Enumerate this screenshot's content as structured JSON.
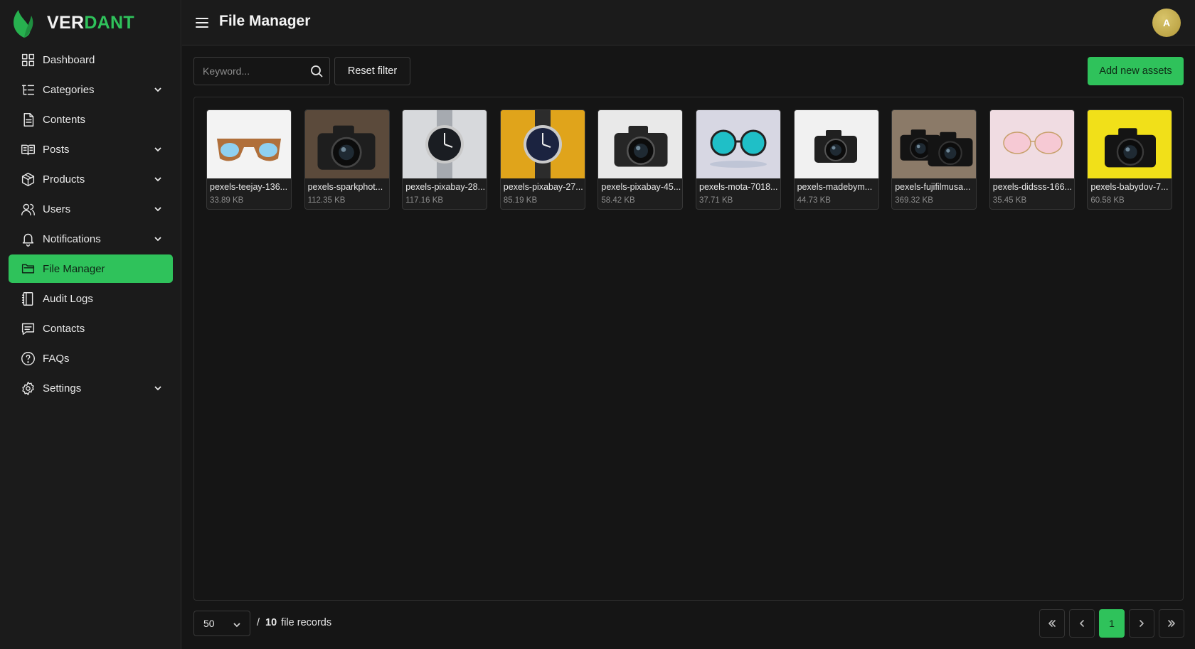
{
  "brand": {
    "name_part1": "VER",
    "name_part2": "DANT",
    "accent": "#2fc25b"
  },
  "header": {
    "title": "File Manager",
    "avatar_initial": "A"
  },
  "sidebar": {
    "items": [
      {
        "label": "Dashboard",
        "icon": "grid-icon",
        "has_chevron": false,
        "active": false
      },
      {
        "label": "Categories",
        "icon": "tree-list-icon",
        "has_chevron": true,
        "active": false
      },
      {
        "label": "Contents",
        "icon": "document-icon",
        "has_chevron": false,
        "active": false
      },
      {
        "label": "Posts",
        "icon": "open-book-icon",
        "has_chevron": true,
        "active": false
      },
      {
        "label": "Products",
        "icon": "box-icon",
        "has_chevron": true,
        "active": false
      },
      {
        "label": "Users",
        "icon": "users-icon",
        "has_chevron": true,
        "active": false
      },
      {
        "label": "Notifications",
        "icon": "bell-icon",
        "has_chevron": true,
        "active": false
      },
      {
        "label": "File Manager",
        "icon": "folders-icon",
        "has_chevron": false,
        "active": true
      },
      {
        "label": "Audit Logs",
        "icon": "notebook-icon",
        "has_chevron": false,
        "active": false
      },
      {
        "label": "Contacts",
        "icon": "chat-icon",
        "has_chevron": false,
        "active": false
      },
      {
        "label": "FAQs",
        "icon": "question-circle-icon",
        "has_chevron": false,
        "active": false
      },
      {
        "label": "Settings",
        "icon": "gear-icon",
        "has_chevron": true,
        "active": false
      }
    ]
  },
  "toolbar": {
    "search_placeholder": "Keyword...",
    "search_value": "",
    "reset_label": "Reset filter",
    "add_label": "Add new assets"
  },
  "files": [
    {
      "name": "pexels-teejay-136...",
      "size": "33.89 KB",
      "thumb": "sunglasses-wood",
      "bg": "#f3f3f3"
    },
    {
      "name": "pexels-sparkphot...",
      "size": "112.35 KB",
      "thumb": "camera-canon",
      "bg": "#5b4a3b"
    },
    {
      "name": "pexels-pixabay-28...",
      "size": "117.16 KB",
      "thumb": "watch-steel",
      "bg": "#d7d9dc"
    },
    {
      "name": "pexels-pixabay-27...",
      "size": "85.19 KB",
      "thumb": "watch-yellow",
      "bg": "#e0a41b"
    },
    {
      "name": "pexels-pixabay-45...",
      "size": "58.42 KB",
      "thumb": "camera-lens",
      "bg": "#e9e9e9"
    },
    {
      "name": "pexels-mota-7018...",
      "size": "37.71 KB",
      "thumb": "sunglasses-round",
      "bg": "#d7d7e3"
    },
    {
      "name": "pexels-madebym...",
      "size": "44.73 KB",
      "thumb": "camera-white",
      "bg": "#f1f1f1"
    },
    {
      "name": "pexels-fujifilmusa...",
      "size": "369.32 KB",
      "thumb": "camera-desk",
      "bg": "#8b7a68"
    },
    {
      "name": "pexels-didsss-166...",
      "size": "35.45 KB",
      "thumb": "glasses-pink",
      "bg": "#f0dce2"
    },
    {
      "name": "pexels-babydov-7...",
      "size": "60.58 KB",
      "thumb": "camera-yellow",
      "bg": "#f1e019"
    }
  ],
  "footer": {
    "per_page": "50",
    "separator": "/",
    "total": "10",
    "records_label": "file records",
    "current_page": "1"
  }
}
